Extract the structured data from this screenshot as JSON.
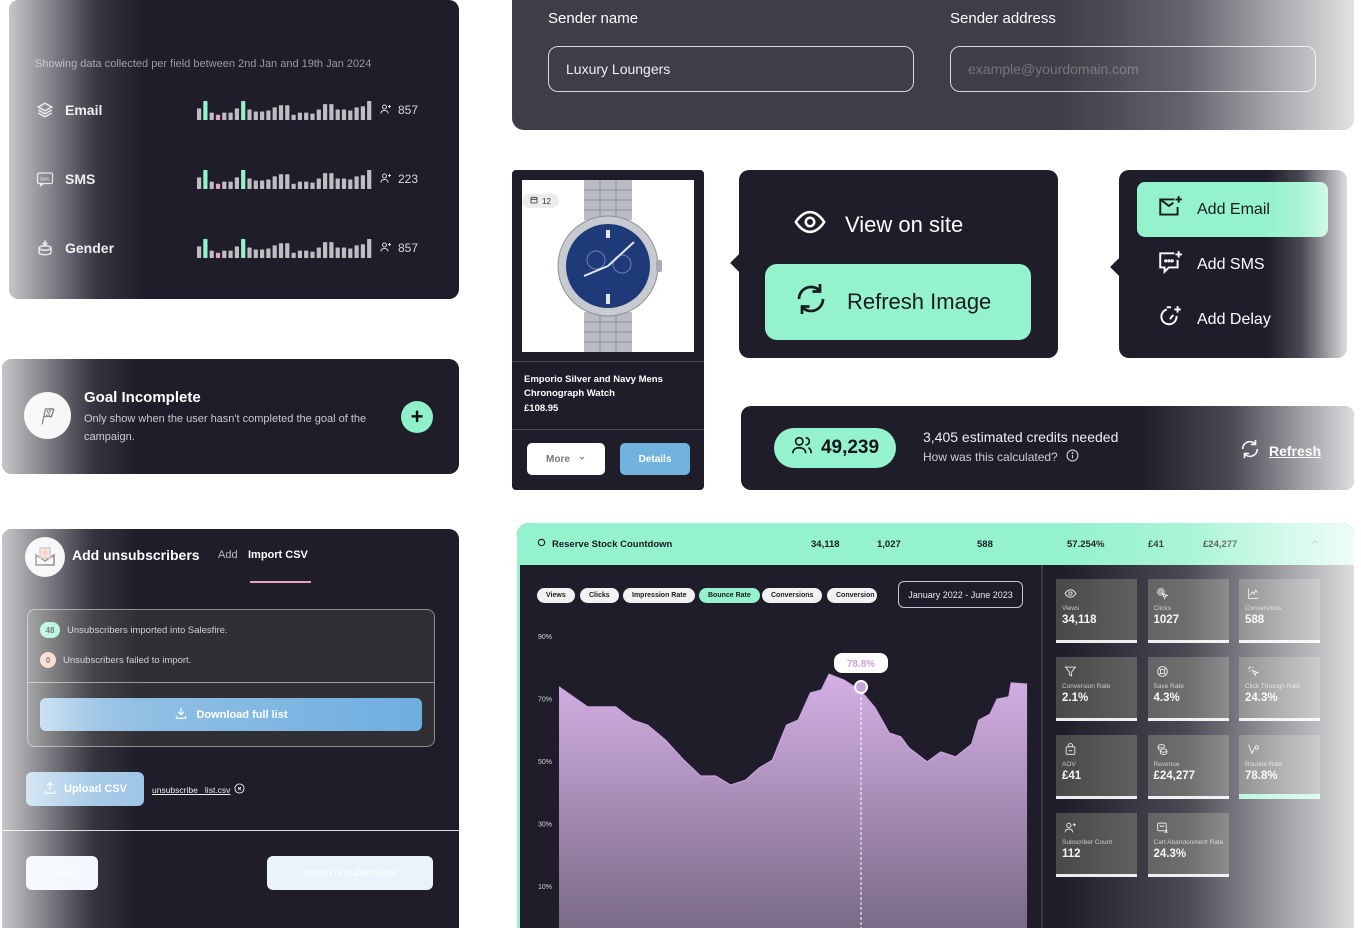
{
  "fields_card": {
    "caption": "Showing data collected per field between 2nd Jan and 19th Jan 2024",
    "rows": [
      {
        "icon": "layers-icon",
        "label": "Email",
        "count": "857",
        "bars": [
          11,
          18,
          7,
          5,
          7,
          7,
          11,
          18,
          10,
          8,
          8,
          9,
          12,
          14,
          14,
          5,
          7,
          7,
          6,
          10,
          15,
          15,
          10,
          10,
          9,
          12,
          13,
          18
        ],
        "highlight": {
          "teal": [
            1,
            7
          ],
          "pink": [
            3
          ]
        }
      },
      {
        "icon": "sms-icon",
        "label": "SMS",
        "count": "223",
        "bars": [
          11,
          18,
          7,
          5,
          7,
          7,
          11,
          18,
          10,
          8,
          8,
          9,
          12,
          14,
          14,
          5,
          7,
          7,
          6,
          10,
          15,
          15,
          10,
          10,
          9,
          12,
          13,
          18
        ],
        "highlight": {
          "teal": [
            1,
            7
          ],
          "pink": [
            3
          ]
        }
      },
      {
        "icon": "database-download-icon",
        "label": "Gender",
        "count": "857",
        "bars": [
          11,
          18,
          7,
          5,
          7,
          7,
          11,
          18,
          10,
          8,
          8,
          9,
          12,
          14,
          14,
          5,
          7,
          7,
          6,
          10,
          15,
          15,
          10,
          10,
          9,
          12,
          13,
          18
        ],
        "highlight": {
          "teal": [
            1,
            7
          ],
          "pink": [
            3
          ]
        }
      }
    ]
  },
  "sender": {
    "name_label": "Sender name",
    "name_value": "Luxury Loungers",
    "address_label": "Sender address",
    "address_placeholder": "example@yourdomain.com"
  },
  "goal": {
    "title": "Goal Incomplete",
    "description": "Only show when the user hasn't completed the goal of the campaign.",
    "add_label": "+"
  },
  "unsubscribers": {
    "title": "Add unsubscribers",
    "tabs": [
      {
        "label": "Add",
        "active": false
      },
      {
        "label": "Import CSV",
        "active": true
      }
    ],
    "imported_count": "48",
    "imported_text": "Unsubscribers imported into Salesfire.",
    "failed_count": "0",
    "failed_text": "Unsubscribers failed to import.",
    "download_label": "Download full list",
    "upload_label": "Upload CSV",
    "file_name": "unsubscribe _list.csv",
    "cancel_label": "Cancel",
    "import_label": "Import unsubscribers"
  },
  "product": {
    "badge_count": "12",
    "name": "Emporio Silver and Navy Mens Chronograph Watch",
    "price": "£108.95",
    "more_label": "More",
    "details_label": "Details"
  },
  "view_menu": {
    "items": [
      {
        "icon": "eye-icon",
        "label": "View on site",
        "active": false
      },
      {
        "icon": "refresh-icon",
        "label": "Refresh Image",
        "active": true
      }
    ]
  },
  "add_menu": {
    "items": [
      {
        "icon": "mail-plus-icon",
        "label": "Add Email",
        "active": true
      },
      {
        "icon": "message-plus-icon",
        "label": "Add SMS",
        "active": false
      },
      {
        "icon": "timer-plus-icon",
        "label": "Add Delay",
        "active": false
      }
    ]
  },
  "credits": {
    "audience": "49,239",
    "estimate": "3,405 estimated credits needed",
    "help": "How was this calculated?",
    "refresh_label": "Refresh"
  },
  "analytics": {
    "campaign": "Reserve Stock Countdown",
    "summary": [
      "34,118",
      "1,027",
      "588",
      "57.254%",
      "£41",
      "£24,277"
    ],
    "chips": [
      {
        "label": "Views",
        "active": false
      },
      {
        "label": "Clicks",
        "active": false
      },
      {
        "label": "Impression Rate",
        "active": false
      },
      {
        "label": "Bounce Rate",
        "active": true
      },
      {
        "label": "Conversions",
        "active": false
      },
      {
        "label": "Conversion",
        "active": false
      }
    ],
    "date_range": "January 2022 - June 2023",
    "tiles": [
      {
        "icon": "eye-icon",
        "label": "Views",
        "value": "34,118",
        "active": false
      },
      {
        "icon": "click-icon",
        "label": "Clicks",
        "value": "1027",
        "active": false
      },
      {
        "icon": "chart-icon",
        "label": "Conversions",
        "value": "588",
        "active": false
      },
      {
        "icon": "filter-icon",
        "label": "Conversion Rate",
        "value": "2.1%",
        "active": false
      },
      {
        "icon": "lifebuoy-icon",
        "label": "Save Rate",
        "value": "4.3%",
        "active": false
      },
      {
        "icon": "sparkle-cursor-icon",
        "label": "Click Through Rate",
        "value": "24.3%",
        "active": false
      },
      {
        "icon": "bag-icon",
        "label": "AOV",
        "value": "£41",
        "active": false
      },
      {
        "icon": "coins-icon",
        "label": "Revenue",
        "value": "£24,277",
        "active": false
      },
      {
        "icon": "bounce-icon",
        "label": "Bounce Rate",
        "value": "78.8%",
        "active": true
      },
      {
        "icon": "user-plus-icon",
        "label": "Subscriber Count",
        "value": "112",
        "active": false
      },
      {
        "icon": "cart-x-icon",
        "label": "Cart Abandonment Rate",
        "value": "24.3%",
        "active": false
      }
    ]
  },
  "chart_data": {
    "type": "area",
    "title": "Bounce Rate",
    "xlabel": "",
    "ylabel": "",
    "y_ticks": [
      "90%",
      "70%",
      "50%",
      "30%",
      "10%"
    ],
    "y_tick_values": [
      90,
      70,
      50,
      30,
      10
    ],
    "ylim": [
      10,
      90
    ],
    "grid": false,
    "series": [
      {
        "name": "Bounce Rate",
        "values": [
          73.7,
          67.3,
          67.3,
          63.1,
          61.5,
          56.7,
          50.3,
          45.2,
          45.2,
          42.3,
          43.9,
          47.8,
          50.3,
          61.5,
          63.1,
          71.8,
          72.7,
          77.8,
          75.9,
          72.4,
          67.0,
          59.0,
          57.7,
          54.2,
          49.7,
          52.9,
          51.3,
          55.4,
          63.1,
          65.0,
          69.8,
          70.5,
          75.0,
          74.6
        ]
      }
    ],
    "x_positions": [
      0,
      0.061,
      0.121,
      0.157,
      0.189,
      0.227,
      0.266,
      0.302,
      0.334,
      0.366,
      0.398,
      0.427,
      0.455,
      0.485,
      0.51,
      0.536,
      0.559,
      0.576,
      0.608,
      0.644,
      0.674,
      0.704,
      0.729,
      0.746,
      0.785,
      0.814,
      0.846,
      0.88,
      0.895,
      0.919,
      0.934,
      0.959,
      0.964,
      0.998
    ],
    "tooltip": {
      "label": "78.8%",
      "index": 19
    }
  }
}
